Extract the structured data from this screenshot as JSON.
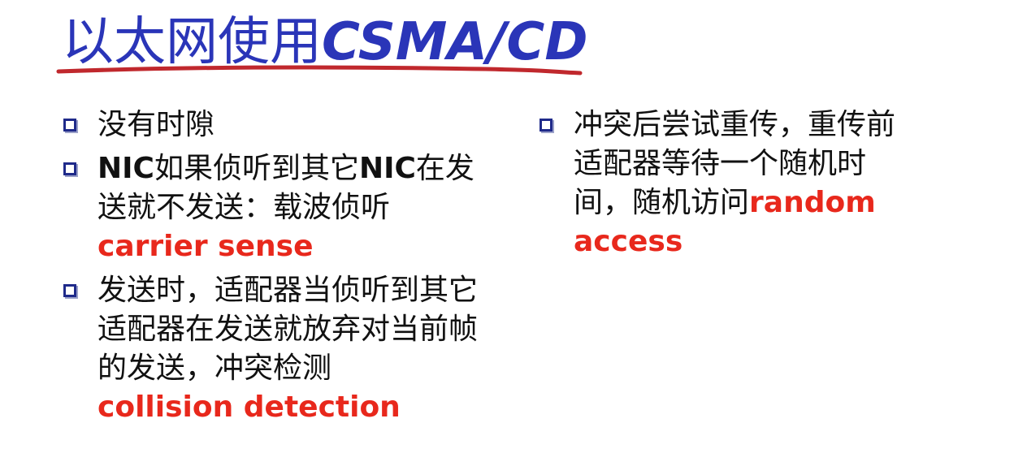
{
  "slide": {
    "title_cjk": "以太网使用",
    "title_latin": "CSMA/CD"
  },
  "left_bullets": {
    "b1": {
      "text": "没有时隙"
    },
    "b2": {
      "nic1": "NIC",
      "text1": "如果侦听到其它",
      "nic2": "NIC",
      "text2": "在发送就不发送：载波侦听",
      "red": "carrier sense"
    },
    "b3": {
      "text": "发送时，适配器当侦听到其它适配器在发送就放弃对当前帧的发送，冲突检测",
      "red": "collision detection"
    }
  },
  "right_bullets": {
    "b1": {
      "text": "冲突后尝试重传，重传前适配器等待一个随机时间，随机访问",
      "red": "random access"
    }
  },
  "colors": {
    "title": "#2a35b8",
    "underline": "#c0282d",
    "bullet_box": "#1f2a8a",
    "accent_red": "#e8281c",
    "text": "#111111"
  }
}
